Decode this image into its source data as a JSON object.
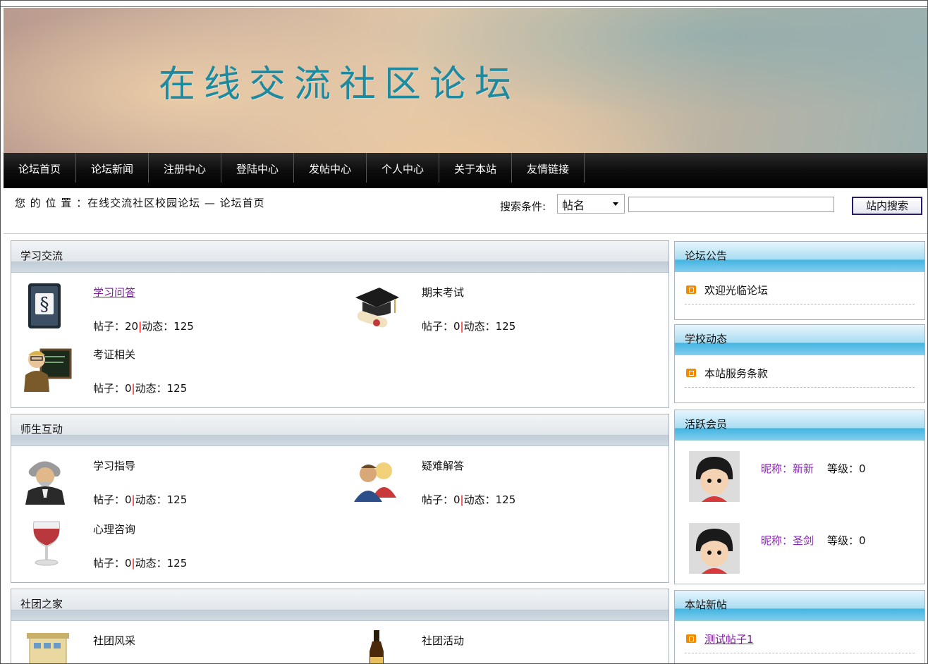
{
  "site_title": "在线交流社区论坛",
  "nav": [
    "论坛首页",
    "论坛新闻",
    "注册中心",
    "登陆中心",
    "发帖中心",
    "个人中心",
    "关于本站",
    "友情链接"
  ],
  "breadcrumb": "您 的 位 置 ：在线交流社区校园论坛 — 论坛首页",
  "search": {
    "label": "搜索条件:",
    "selected": "帖名",
    "input_value": "",
    "button": "站内搜索"
  },
  "sections": [
    {
      "title": "学习交流",
      "forums": [
        {
          "name": "学习问答",
          "posts_label": "帖子：20",
          "activity_label": "动态：125",
          "icon": "law-book-icon"
        },
        {
          "name": "期末考试",
          "posts_label": "帖子：0",
          "activity_label": "动态：125",
          "icon": "graduation-cap-icon"
        },
        {
          "name": "考证相关",
          "posts_label": "帖子：0",
          "activity_label": "动态：125",
          "icon": "teacher-blackboard-icon"
        }
      ]
    },
    {
      "title": "师生互动",
      "forums": [
        {
          "name": "学习指导",
          "posts_label": "帖子：0",
          "activity_label": "动态：125",
          "icon": "professor-icon"
        },
        {
          "name": "疑难解答",
          "posts_label": "帖子：0",
          "activity_label": "动态：125",
          "icon": "users-icon"
        },
        {
          "name": "心理咨询",
          "posts_label": "帖子：0",
          "activity_label": "动态：125",
          "icon": "wine-glass-icon"
        }
      ]
    },
    {
      "title": "社团之家",
      "forums": [
        {
          "name": "社团风采",
          "icon": "building-icon"
        },
        {
          "name": "社团活动",
          "icon": "bottle-icon"
        }
      ]
    }
  ],
  "sidebar": {
    "announcements": {
      "title": "论坛公告",
      "items": [
        "欢迎光临论坛"
      ]
    },
    "school_news": {
      "title": "学校动态",
      "items": [
        "本站服务条款"
      ]
    },
    "active_members": {
      "title": "活跃会员",
      "members": [
        {
          "nick": "昵称：新新",
          "level": "等级：0"
        },
        {
          "nick": "昵称：圣剑",
          "level": "等级：0"
        }
      ]
    },
    "new_posts": {
      "title": "本站新帖",
      "items": [
        "测试帖子1"
      ]
    }
  },
  "colors": {
    "nav_bg": "#000000",
    "title": "#1d8aa0",
    "link": "#7a1f9a",
    "separator": "#e00000",
    "bullet": "#f08a00"
  }
}
